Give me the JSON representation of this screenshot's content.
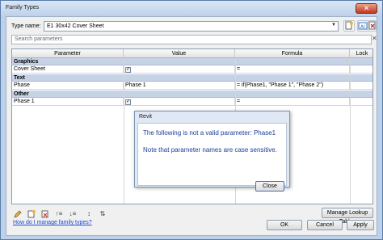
{
  "window": {
    "title": "Family Types"
  },
  "type_row": {
    "label": "Type name:",
    "value": "E1 30x42 Cover Sheet"
  },
  "search": {
    "placeholder": "Search parameters"
  },
  "columns": [
    "Parameter",
    "Value",
    "Formula",
    "Lock"
  ],
  "groups": [
    {
      "name": "Graphics",
      "rows": [
        {
          "parameter": "Cover Sheet",
          "value": "checkbox-checked",
          "formula": "="
        }
      ]
    },
    {
      "name": "Text",
      "rows": [
        {
          "parameter": "Phase",
          "value": "Phase 1",
          "formula": "= if(Phase1, \"Phase 1\", \"Phase 2\")"
        }
      ]
    },
    {
      "name": "Other",
      "rows": [
        {
          "parameter": "Phase 1",
          "value": "checkbox-checked",
          "formula": "="
        }
      ]
    }
  ],
  "dialog": {
    "title": "Revit",
    "message_1": "The following is not a valid parameter:  Phase1",
    "message_2": "Note that parameter names are case sensitive.",
    "close_label": "Close"
  },
  "buttons": {
    "manage_lookup": "Manage Lookup Tables",
    "ok": "OK",
    "cancel": "Cancel",
    "apply": "Apply"
  },
  "help_link": "How do I manage family types?",
  "icons": [
    "pencil-icon",
    "new-parameter-icon",
    "delete-parameter-icon",
    "sort-asc-icon",
    "sort-desc-icon",
    "move-up-icon",
    "move-down-icon"
  ]
}
